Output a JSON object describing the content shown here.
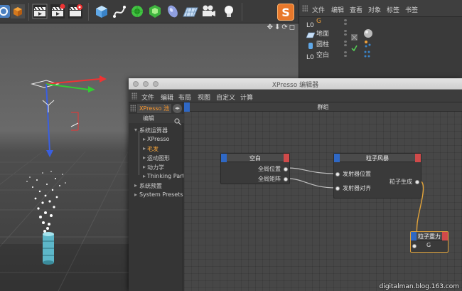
{
  "colors": {
    "accent_orange": "#f0a13a",
    "port_blue": "#2f68c5",
    "port_red": "#d04a4a",
    "wire_orange": "#e3a43a"
  },
  "toolbar": {
    "icons": [
      "selection-icon",
      "cube-object-icon",
      "render-view-icon",
      "render-picture-viewer-icon",
      "render-settings-icon",
      "cube-primitive-icon",
      "spline-pen-icon",
      "nurbs-icon",
      "array-icon",
      "deformer-icon",
      "floor-icon",
      "camera-icon",
      "light-icon"
    ]
  },
  "viewport": {
    "nav_glyphs": "✥⬇⟳◻"
  },
  "object_manager": {
    "menu": [
      "文件",
      "编辑",
      "查看",
      "对象",
      "标签",
      "书签"
    ],
    "objects": [
      {
        "name": "G",
        "icon": "null-object-icon",
        "highlight": true
      },
      {
        "name": "地面",
        "icon": "floor-icon",
        "highlight": false
      },
      {
        "name": "圆柱",
        "icon": "cylinder-icon",
        "highlight": false
      },
      {
        "name": "空白",
        "icon": "null-object-icon",
        "highlight": false
      }
    ],
    "logo": "S"
  },
  "xpresso": {
    "title": "XPresso 编辑器",
    "menu": [
      "文件",
      "编辑",
      "布局",
      "视图",
      "自定义",
      "计算"
    ],
    "pool_tab": "XPresso 池",
    "pool_edit": "编辑",
    "pool_tree": [
      {
        "label": "系统运算器",
        "indent": 0,
        "orange": false
      },
      {
        "label": "XPresso",
        "indent": 1,
        "orange": false
      },
      {
        "label": "毛发",
        "indent": 1,
        "orange": true
      },
      {
        "label": "运动图形",
        "indent": 1,
        "orange": false
      },
      {
        "label": "动力学",
        "indent": 1,
        "orange": false
      },
      {
        "label": "Thinking Particles",
        "indent": 1,
        "orange": false
      },
      {
        "label": "系统预置",
        "indent": 0,
        "orange": false
      },
      {
        "label": "System Presets",
        "indent": 0,
        "orange": false
      }
    ],
    "group_label": "群组",
    "nodes": {
      "null_node": {
        "title": "空白",
        "ports": [
          "全局位置",
          "全局矩阵"
        ]
      },
      "emitter_node": {
        "title": "粒子风暴",
        "in_ports": [
          "发射器位置",
          "发射器对齐"
        ],
        "out_port": "粒子生成"
      },
      "gravity_node": {
        "title": "粒子重力",
        "port": "G"
      }
    }
  },
  "watermark": "digitalman.blog.163.com"
}
